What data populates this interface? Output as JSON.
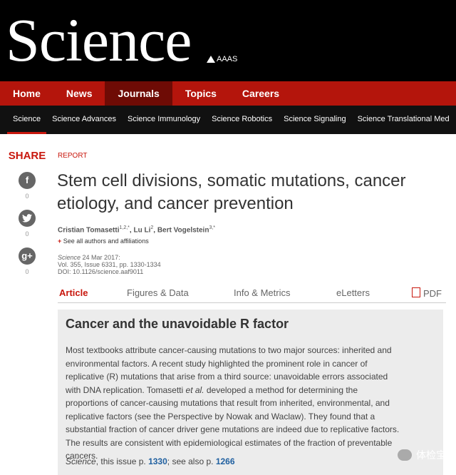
{
  "masthead": {
    "logo": "Science",
    "aaas": "AAAS"
  },
  "main_nav": [
    {
      "label": "Home"
    },
    {
      "label": "News"
    },
    {
      "label": "Journals"
    },
    {
      "label": "Topics"
    },
    {
      "label": "Careers"
    }
  ],
  "sub_nav": [
    {
      "label": "Science"
    },
    {
      "label": "Science Advances"
    },
    {
      "label": "Science Immunology"
    },
    {
      "label": "Science Robotics"
    },
    {
      "label": "Science Signaling"
    },
    {
      "label": "Science Translational Med"
    }
  ],
  "share": {
    "title": "SHARE",
    "facebook_count": "0",
    "twitter_count": "0",
    "googleplus_count": "0"
  },
  "article": {
    "type": "REPORT",
    "title": "Stem cell divisions, somatic mutations, cancer etiology, and cancer prevention",
    "authors": {
      "a1": "Cristian Tomasetti",
      "a1_sup": "1,2,*",
      "a2": "Lu Li",
      "a2_sup": "2",
      "a3": "Bert Vogelstein",
      "a3_sup": "3,*"
    },
    "see_all": "See all authors and affiliations",
    "journal": "Science",
    "date": "24 Mar 2017:",
    "volume": "Vol. 355, Issue 6331, pp. 1330-1334",
    "doi": "DOI: 10.1126/science.aaf9011"
  },
  "tabs": [
    {
      "label": "Article"
    },
    {
      "label": "Figures & Data"
    },
    {
      "label": "Info & Metrics"
    },
    {
      "label": "eLetters"
    },
    {
      "label": "PDF"
    }
  ],
  "abstract": {
    "title": "Cancer and the unavoidable R factor",
    "p1": "Most textbooks attribute cancer-causing mutations to two major sources: inherited and environmental factors. A recent study highlighted the prominent role in cancer of replicative (R) mutations that arise from a third source: unavoidable errors associated with DNA replication. Tomasetti ",
    "p1_italic": "et al.",
    "p2": " developed a method for determining the proportions of cancer-causing mutations that result from inherited, environmental, and replicative factors (see the Perspective by Nowak and Waclaw). They found that a substantial fraction of cancer driver gene mutations are indeed due to replicative factors. The results are consistent with epidemiological estimates of the fraction of preventable cancers.",
    "foot_journal": "Science",
    "foot_text1": ", this issue p. ",
    "foot_page1": "1330",
    "foot_text2": "; see also p. ",
    "foot_page2": "1266"
  },
  "watermark": {
    "text": "体检宝"
  }
}
